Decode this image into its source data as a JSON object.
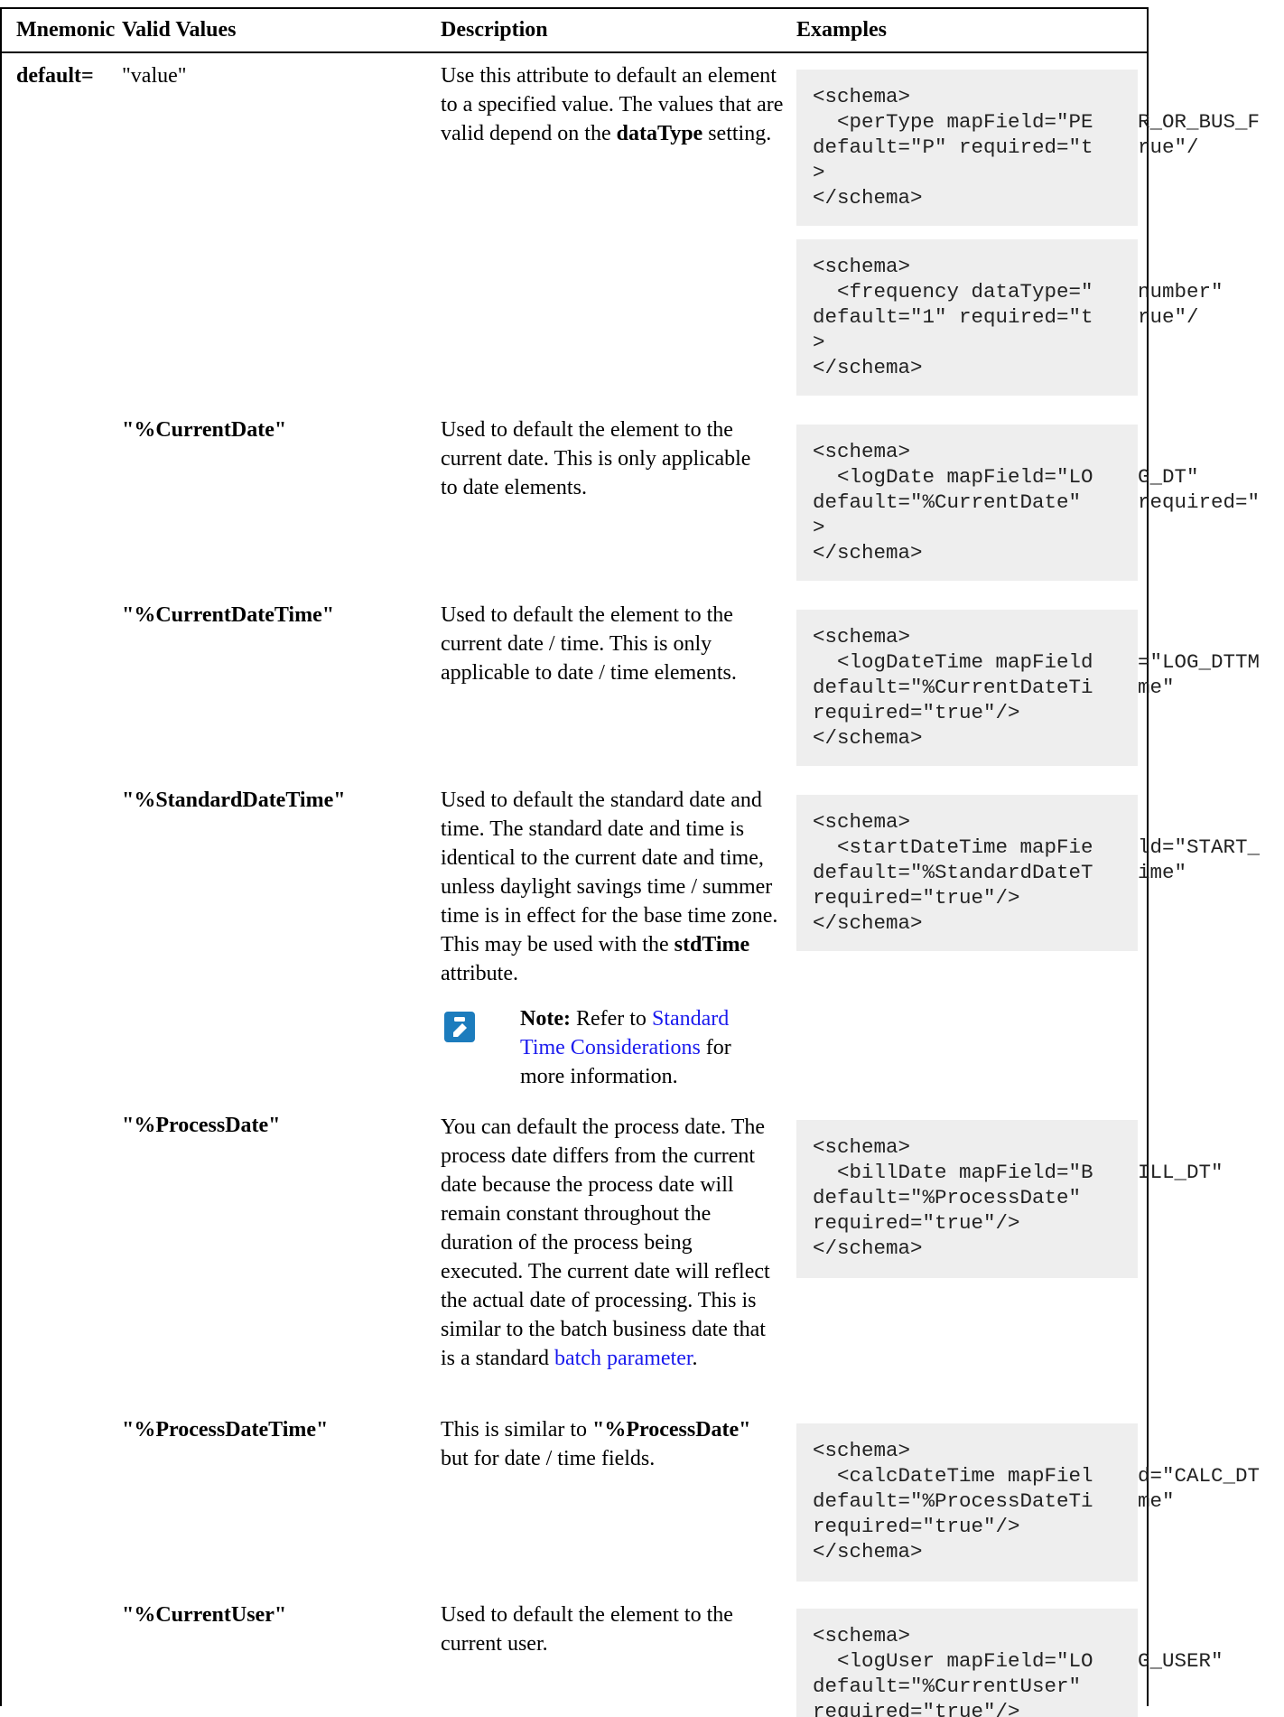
{
  "table": {
    "headers": {
      "mnemonic": "Mnemonic",
      "valid_values": "Valid Values",
      "description": "Description",
      "examples": "Examples"
    },
    "rows": [
      {
        "mnemonic": "default=",
        "value": "\"value\"",
        "description_parts": [
          "Use this attribute to default an element to a specified value. The values that are valid depend on the ",
          "dataType",
          " setting."
        ],
        "examples": [
          "<schema>\n  <perType mapField=\"PE\ndefault=\"P\" required=\"t\n>\n</schema>",
          "<schema>\n  <frequency dataType=\"\ndefault=\"1\" required=\"t\n>\n</schema>"
        ]
      },
      {
        "value": "\"%CurrentDate\"",
        "description": "Used to default the element to the current date. This is only applicable to date elements.",
        "example": "<schema>\n  <logDate mapField=\"LO\ndefault=\"%CurrentDate\" \n>\n</schema>"
      },
      {
        "value": "\"%CurrentDateTime\"",
        "description": "Used to default the element to the current date / time. This is only applicable to date / time elements.",
        "example": "<schema>\n  <logDateTime mapField\ndefault=\"%CurrentDateTi\nrequired=\"true\"/>\n</schema>"
      },
      {
        "value": "\"%StandardDateTime\"",
        "description_parts": [
          "Used to default the standard date and time. The standard date and time is identical to the current date and time, unless daylight savings time / summer time is in effect for the base time zone. This may be used with the ",
          "stdTime",
          " attribute."
        ],
        "note": {
          "icon": "note-pencil-icon",
          "label": "Note:",
          "text_before": "Refer to ",
          "link": "Standard Time Considerations",
          "text_after": " for more information."
        },
        "example": "<schema>\n  <startDateTime mapFie\ndefault=\"%StandardDateT\nrequired=\"true\"/>\n</schema>"
      },
      {
        "value": "\"%ProcessDate\"",
        "description_parts": [
          "You can default the process date. The process date differs from the current date because the process date will remain constant throughout the duration of the process being executed. The current date will reflect the actual date of processing. This is similar to the batch business date that is a standard ",
          "batch parameter",
          "."
        ],
        "example": "<schema>\n  <billDate mapField=\"B\ndefault=\"%ProcessDate\"\nrequired=\"true\"/>\n</schema>"
      },
      {
        "value": "\"%ProcessDateTime\"",
        "description_parts": [
          "This is similar to ",
          "\"%ProcessDate\"",
          " but for date / time fields."
        ],
        "example": "<schema>\n  <calcDateTime mapFiel\ndefault=\"%ProcessDateTi\nrequired=\"true\"/>\n</schema>"
      },
      {
        "value": "\"%CurrentUser\"",
        "description": "Used to default the element to the current user.",
        "example": "<schema>\n  <logUser mapField=\"LO\ndefault=\"%CurrentUser\"\nrequired=\"true\"/>"
      }
    ],
    "overflow_fragments": [
      "R_OR_BUS_F",
      "rue\"/",
      "number\"",
      "rue\"/",
      "G_DT\"",
      "required=\"",
      "=\"LOG_DTTM",
      "me\"",
      "ld=\"START_",
      "ime\"",
      "ILL_DT\"",
      "d=\"CALC_DT",
      "me\"",
      "G_USER\""
    ]
  }
}
